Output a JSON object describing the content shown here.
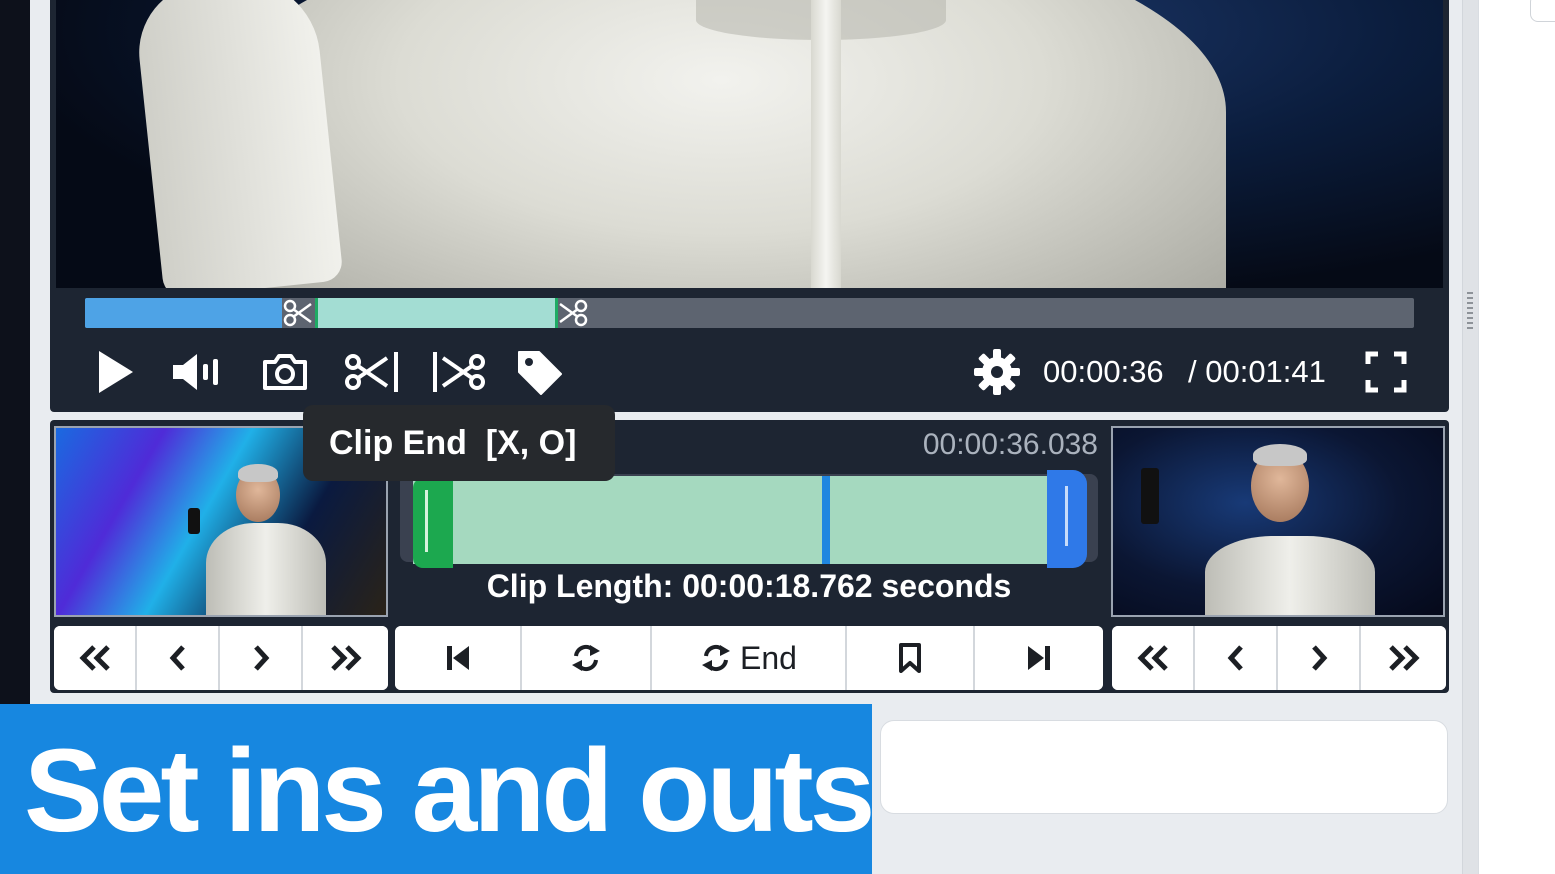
{
  "player": {
    "current_time": "00:00:36",
    "duration": "/ 00:01:41",
    "played_fraction": 0.148,
    "clip_start_fraction": 0.173,
    "clip_end_fraction": 0.356
  },
  "controls": {
    "icons": [
      "play-icon",
      "volume-icon",
      "camera-icon",
      "clip-start-icon",
      "clip-end-icon",
      "tag-icon",
      "gear-icon",
      "fullscreen-icon"
    ]
  },
  "tooltip": {
    "text": "Clip End  [X, O]"
  },
  "editor": {
    "clip_time": "00:00:36.038",
    "clip_length": "Clip Length: 00:00:18.762 seconds",
    "playhead_fraction": 0.62,
    "center_buttons": {
      "loop_end_label": "End"
    }
  },
  "banner": {
    "text": "Set ins and outs"
  },
  "colors": {
    "accent_blue": "#1787e0",
    "clip_green": "#1ca84f",
    "clip_fill": "#a5d9bf",
    "timeline_played": "#4ea3e6",
    "panel_bg": "#1d2532"
  }
}
